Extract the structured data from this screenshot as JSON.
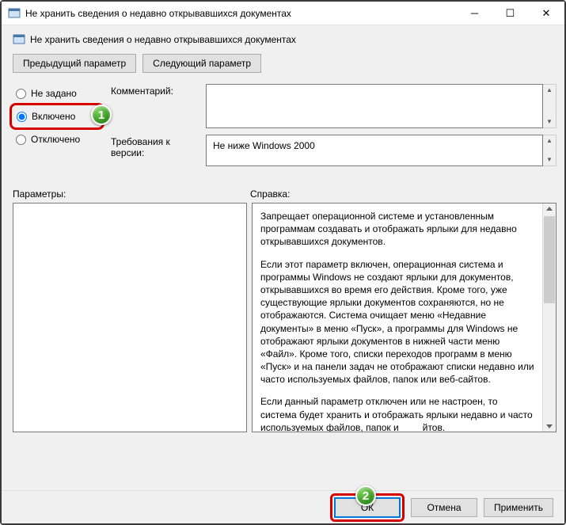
{
  "window": {
    "title": "Не хранить сведения о недавно открывавшихся документах",
    "subtitle": "Не хранить сведения о недавно открывавшихся документах"
  },
  "nav": {
    "prev": "Предыдущий параметр",
    "next": "Следующий параметр"
  },
  "radios": {
    "not_configured": "Не задано",
    "enabled": "Включено",
    "disabled": "Отключено"
  },
  "labels": {
    "comment": "Комментарий:",
    "version_req": "Требования к версии:",
    "parameters": "Параметры:",
    "help": "Справка:"
  },
  "version_value": "Не ниже Windows 2000",
  "help": {
    "p1": "Запрещает операционной системе и установленным программам создавать и отображать ярлыки для недавно открывавшихся документов.",
    "p2": "Если этот параметр включен, операционная система и программы Windows не создают ярлыки для документов, открывавшихся во время его действия. Кроме того, уже существующие ярлыки документов сохраняются, но не отображаются. Система очищает меню «Недавние документы» в меню «Пуск», а программы для Windows не отображают ярлыки документов в нижней части меню «Файл». Кроме того, списки переходов программ в меню «Пуск» и на панели задач не отображают списки недавно или часто используемых файлов, папок или веб-сайтов.",
    "p3_a": "Если данный параметр отключен или не настроен, то система будет хранить и отображать ярлыки недавно и часто используемых файлов, папок и",
    "p3_b": "йтов."
  },
  "buttons": {
    "ok": "ОК",
    "cancel": "Отмена",
    "apply": "Применить"
  },
  "badges": {
    "one": "1",
    "two": "2"
  }
}
